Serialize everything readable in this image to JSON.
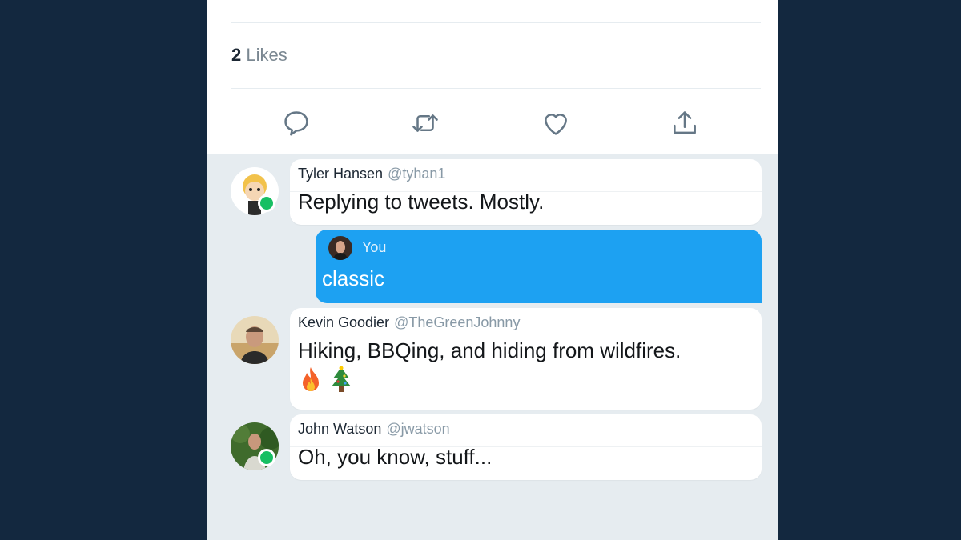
{
  "tweet": {
    "likes_count": "2",
    "likes_label": "Likes",
    "actions": [
      "reply-icon",
      "retweet-icon",
      "like-icon",
      "share-icon"
    ]
  },
  "replies": [
    {
      "name": "Tyler Hansen",
      "handle": "@tyhan1",
      "text": "Replying to tweets. Mostly.",
      "online": true
    },
    {
      "name": "Kevin Goodier",
      "handle": "@TheGreenJohnny",
      "text": "Hiking, BBQing, and hiding from wildfires.",
      "emojis": [
        "fire-emoji",
        "christmas-tree-emoji"
      ],
      "online": false
    },
    {
      "name": "John Watson",
      "handle": "@jwatson",
      "text": "Oh, you know, stuff...",
      "online": true
    }
  ],
  "own_message": {
    "label": "You",
    "text": "classic"
  },
  "colors": {
    "background": "#13283f",
    "accent": "#1da1f2",
    "online": "#17bf63",
    "icon": "#657786"
  }
}
